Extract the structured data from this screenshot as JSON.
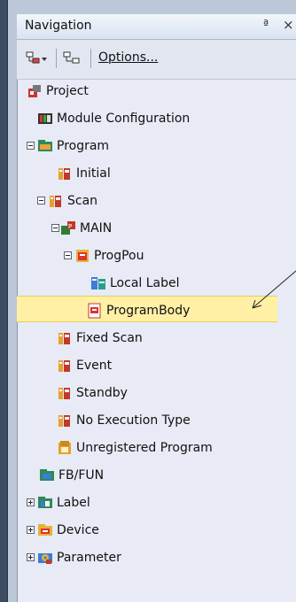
{
  "panel": {
    "title": "Navigation",
    "pin_icon": "pin-icon",
    "close_icon": "close-icon",
    "close_glyph": "×",
    "pin_glyph": "ª"
  },
  "toolbar": {
    "options_label": "Options...",
    "buttons": [
      "tree-view-dropdown-icon",
      "collapse-tree-icon"
    ]
  },
  "tree": [
    {
      "label": "Project",
      "icon": "project-icon",
      "expander": ""
    },
    {
      "label": "Module Configuration",
      "icon": "module-configuration-icon",
      "expander": ""
    },
    {
      "label": "Program",
      "icon": "program-folder-icon",
      "expander": "minus"
    },
    {
      "label": "Initial",
      "icon": "program-block-icon",
      "expander": ""
    },
    {
      "label": "Scan",
      "icon": "program-block-icon",
      "expander": "minus"
    },
    {
      "label": "MAIN",
      "icon": "program-file-icon",
      "expander": "minus"
    },
    {
      "label": "ProgPou",
      "icon": "pou-icon",
      "expander": "minus"
    },
    {
      "label": "Local Label",
      "icon": "local-label-icon",
      "expander": ""
    },
    {
      "label": "ProgramBody",
      "icon": "program-body-icon",
      "expander": "",
      "selected": true
    },
    {
      "label": "Fixed Scan",
      "icon": "program-block-icon",
      "expander": ""
    },
    {
      "label": "Event",
      "icon": "program-block-icon",
      "expander": ""
    },
    {
      "label": "Standby",
      "icon": "program-block-icon",
      "expander": ""
    },
    {
      "label": "No Execution Type",
      "icon": "program-block-icon",
      "expander": ""
    },
    {
      "label": "Unregistered Program",
      "icon": "unregistered-program-icon",
      "expander": ""
    },
    {
      "label": "FB/FUN",
      "icon": "fb-fun-icon",
      "expander": ""
    },
    {
      "label": "Label",
      "icon": "label-icon",
      "expander": "plus"
    },
    {
      "label": "Device",
      "icon": "device-icon",
      "expander": "plus"
    },
    {
      "label": "Parameter",
      "icon": "parameter-icon",
      "expander": "plus"
    }
  ]
}
